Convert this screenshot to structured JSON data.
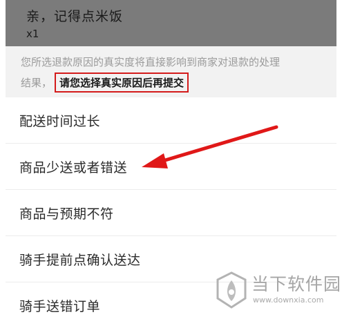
{
  "product": {
    "name": "亲，记得点米饭",
    "quantity": "x1"
  },
  "notice": {
    "line1": "您所选退款原因的真实度将直接影响到商家对退款的处理",
    "line2_prefix": "结果，",
    "highlight": "请您选择真实原因后再提交"
  },
  "reasons": [
    {
      "label": "配送时间过长"
    },
    {
      "label": "商品少送或者错送"
    },
    {
      "label": "商品与预期不符"
    },
    {
      "label": "骑手提前点确认送达"
    },
    {
      "label": "骑手送错订单"
    }
  ],
  "watermark": {
    "title": "当下软件园",
    "url": "www.downxia.com"
  },
  "colors": {
    "annotation_red": "#d41a1a",
    "overlay_gray": "#7b7b7b",
    "notice_bg": "#f2f2f2",
    "text_dark": "#2a2a2a",
    "text_gray": "#9a9a9a"
  }
}
